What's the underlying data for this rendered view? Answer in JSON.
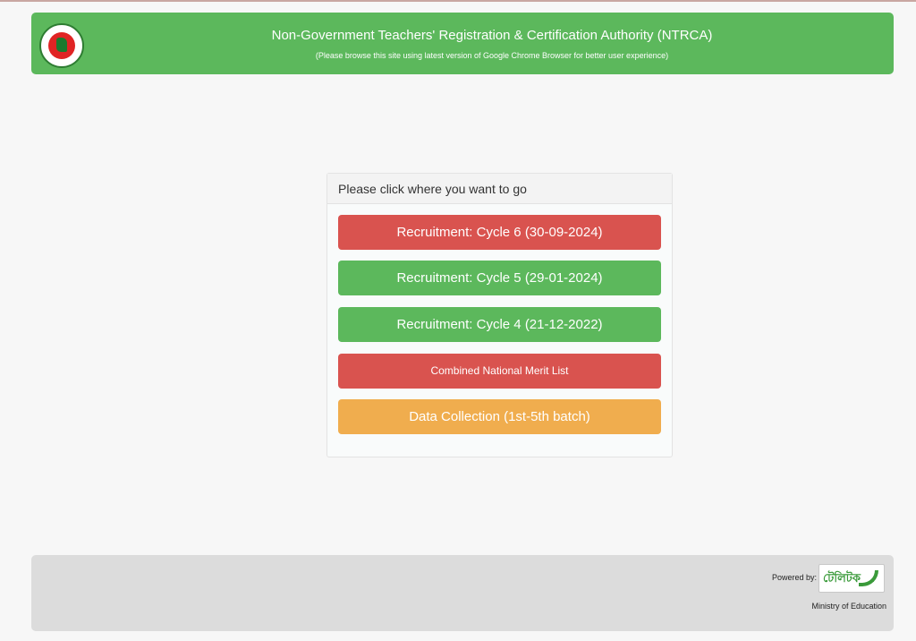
{
  "header": {
    "title": "Non-Government Teachers' Registration & Certification Authority (NTRCA)",
    "subtitle": "(Please browse this site using latest version of Google Chrome Browser for better user experience)"
  },
  "panel": {
    "heading": "Please click where you want to go",
    "buttons": [
      {
        "label": "Recruitment: Cycle 6 (30-09-2024)",
        "color": "#d9534f"
      },
      {
        "label": "Recruitment: Cycle 5 (29-01-2024)",
        "color": "#5cb85c"
      },
      {
        "label": "Recruitment: Cycle 4 (21-12-2022)",
        "color": "#5cb85c"
      },
      {
        "label": "Combined National Merit List",
        "color": "#d9534f"
      },
      {
        "label": "Data Collection (1st-5th batch)",
        "color": "#f0ad4e"
      }
    ]
  },
  "footer": {
    "powered_by": "Powered by:",
    "partner_logo_text": "টেলিটক",
    "ministry": "Ministry of Education"
  },
  "colors": {
    "header_bg": "#5cb85c",
    "footer_bg": "#dcdcdc",
    "page_bg": "#f7f7f7"
  }
}
